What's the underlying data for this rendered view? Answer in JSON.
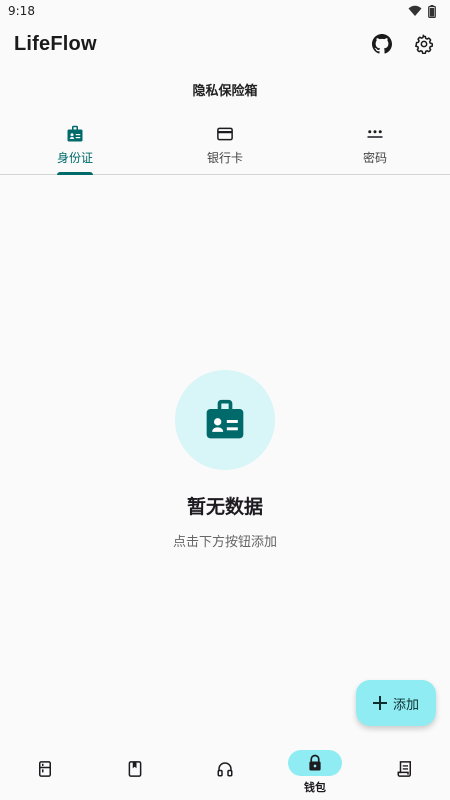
{
  "status_bar": {
    "time": "9:18"
  },
  "app_bar": {
    "title": "LifeFlow"
  },
  "section": {
    "title": "隐私保险箱"
  },
  "tabs": [
    {
      "label": "身份证",
      "icon": "id-badge-icon",
      "active": true
    },
    {
      "label": "银行卡",
      "icon": "credit-card-icon",
      "active": false
    },
    {
      "label": "密码",
      "icon": "password-dots-icon",
      "active": false
    }
  ],
  "empty_state": {
    "title": "暂无数据",
    "subtitle": "点击下方按钮添加",
    "icon": "id-badge-icon"
  },
  "fab": {
    "label": "添加",
    "icon": "plus-icon"
  },
  "bottom_nav": [
    {
      "icon": "fridge-icon",
      "label": "",
      "active": false
    },
    {
      "icon": "bookmark-book-icon",
      "label": "",
      "active": false
    },
    {
      "icon": "headphones-icon",
      "label": "",
      "active": false
    },
    {
      "icon": "lock-icon",
      "label": "钱包",
      "active": true
    },
    {
      "icon": "receipt-icon",
      "label": "",
      "active": false
    }
  ],
  "colors": {
    "accent": "#006a6a",
    "fab_bg": "#8fecf2",
    "empty_circle": "#d8f5f7",
    "background": "#fafafa"
  }
}
